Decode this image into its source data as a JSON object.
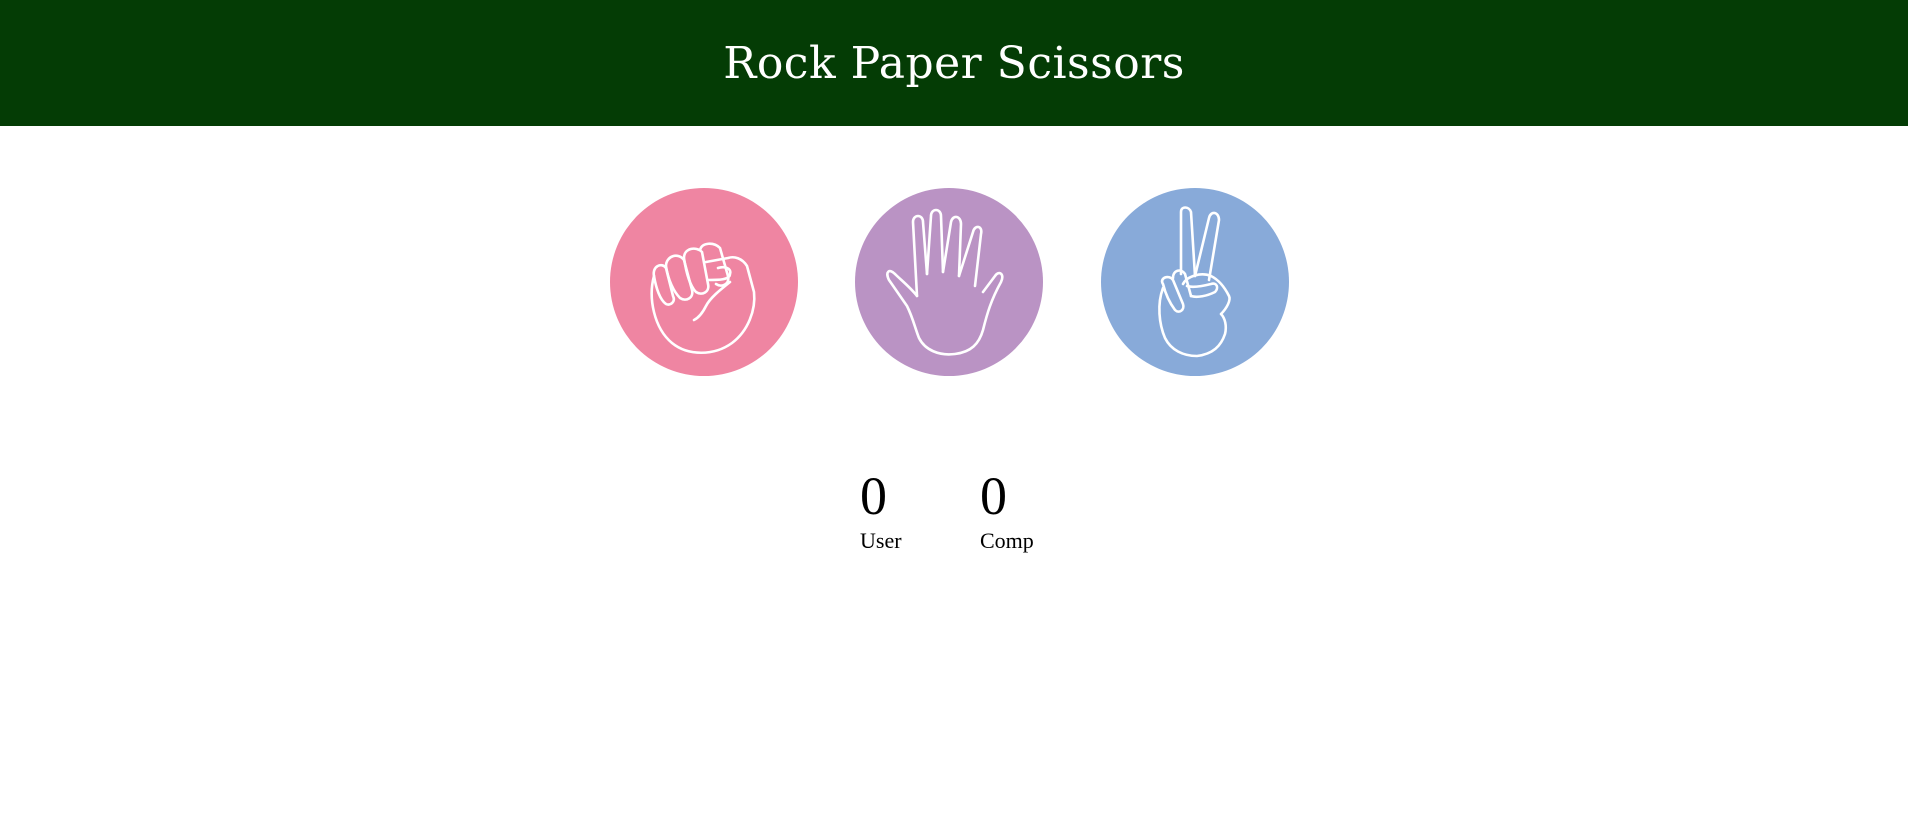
{
  "header": {
    "title": "Rock Paper Scissors",
    "background_color": "#043c05"
  },
  "choices": [
    {
      "id": "rock",
      "icon": "fist-icon",
      "color": "#ef85a2"
    },
    {
      "id": "paper",
      "icon": "open-hand-icon",
      "color": "#ba93c4"
    },
    {
      "id": "scissors",
      "icon": "peace-hand-icon",
      "color": "#88aad9"
    }
  ],
  "scoreboard": {
    "user": {
      "score": "0",
      "label": "User"
    },
    "comp": {
      "score": "0",
      "label": "Comp"
    }
  }
}
